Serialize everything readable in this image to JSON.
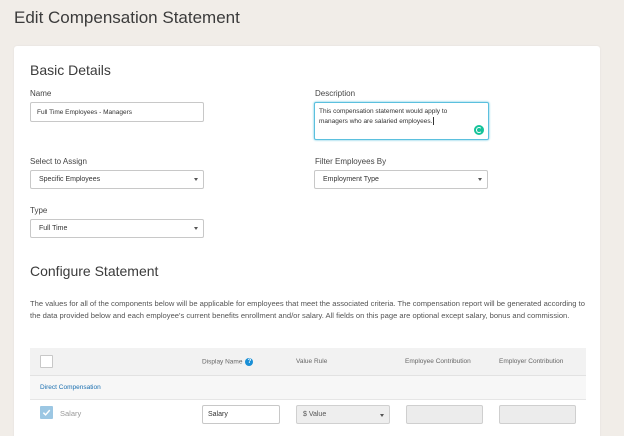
{
  "page": {
    "title": "Edit Compensation Statement"
  },
  "basic_details": {
    "title": "Basic Details",
    "name_label": "Name",
    "name_value": "Full Time Employees - Managers",
    "description_label": "Description",
    "description_line1": "This compensation statement would apply to",
    "description_line2": "managers who are salaried employees.",
    "assign_label": "Select to Assign",
    "assign_value": "Specific Employees",
    "filter_label": "Filter Employees By",
    "filter_value": "Employment Type",
    "type_label": "Type",
    "type_value": "Full Time"
  },
  "configure": {
    "title": "Configure Statement",
    "description": "The values for all of the components below will be applicable for employees that meet the associated criteria. The compensation report will be generated according to the data provided below and each employee's current benefits enrollment and/or salary. All fields on this page are optional except salary, bonus and commission."
  },
  "table": {
    "headers": {
      "display_name": "Display Name",
      "value_rule": "Value Rule",
      "employee_contribution": "Employee Contribution",
      "employer_contribution": "Employer Contribution"
    },
    "help_icon": "?",
    "group_label": "Direct Compensation",
    "rows": [
      {
        "label": "Salary",
        "display_name": "Salary",
        "value_rule": "$ Value",
        "checked": true
      }
    ]
  },
  "colors": {
    "background": "#f1ede8",
    "accent": "#1a8fd6",
    "focus": "#5bc0de",
    "grammarly": "#15c39a"
  }
}
